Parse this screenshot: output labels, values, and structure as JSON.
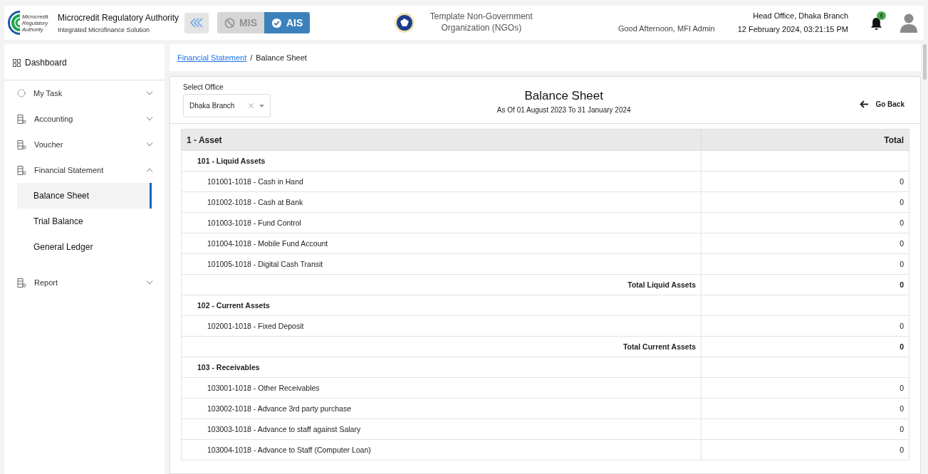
{
  "header": {
    "org_name": "Microcredit Regulatory Authority",
    "org_subtitle": "Integrated Microfinance Solution",
    "logo_text": "Microcredit Regulatory Authority",
    "modules": [
      {
        "label": "MIS",
        "selected": false
      },
      {
        "label": "AIS",
        "selected": true
      }
    ],
    "organization": "Template Non-Government Organization (NGOs)",
    "greeting": "Good Afternoon, MFI Admin",
    "office": "Head Office, Dhaka Branch",
    "datetime": "12 February 2024, 03:21:15 PM",
    "notification_count": "8"
  },
  "sidebar": {
    "dashboard": "Dashboard",
    "items": [
      {
        "label": "My Task",
        "kind": "task",
        "expanded": false
      },
      {
        "label": "Accounting",
        "kind": "doc",
        "expanded": false
      },
      {
        "label": "Voucher",
        "kind": "doc",
        "expanded": false
      },
      {
        "label": "Financial Statement",
        "kind": "doc",
        "expanded": true,
        "children": [
          {
            "label": "Balance Sheet",
            "selected": true
          },
          {
            "label": "Trial Balance",
            "selected": false
          },
          {
            "label": "General Ledger",
            "selected": false
          }
        ]
      },
      {
        "label": "Report",
        "kind": "doc",
        "expanded": false
      }
    ]
  },
  "breadcrumb": {
    "separator": "/",
    "items": [
      {
        "label": "Financial Statement",
        "link": true
      },
      {
        "label": "Balance Sheet",
        "link": false
      }
    ]
  },
  "report": {
    "office_label": "Select Office",
    "office_value": "Dhaka Branch",
    "title": "Balance Sheet",
    "period": "As Of 01 August 2023 To 31 January 2024",
    "back": "Go Back",
    "columns": [
      "1 - Asset",
      "Total"
    ],
    "rows": [
      {
        "kind": "group",
        "label": "101 - Liquid Assets"
      },
      {
        "kind": "account",
        "label": "101001-1018 - Cash in Hand",
        "value": "0"
      },
      {
        "kind": "account",
        "label": "101002-1018 - Cash at Bank",
        "value": "0"
      },
      {
        "kind": "account",
        "label": "101003-1018 - Fund Control",
        "value": "0"
      },
      {
        "kind": "account",
        "label": "101004-1018 - Mobile Fund Account",
        "value": "0"
      },
      {
        "kind": "account",
        "label": "101005-1018 - Digital Cash Transit",
        "value": "0"
      },
      {
        "kind": "total",
        "label": "Total Liquid Assets",
        "value": "0"
      },
      {
        "kind": "group",
        "label": "102 - Current Assets"
      },
      {
        "kind": "account",
        "label": "102001-1018 - Fixed Deposit",
        "value": "0"
      },
      {
        "kind": "total",
        "label": "Total Current Assets",
        "value": "0"
      },
      {
        "kind": "group",
        "label": "103 - Receivables"
      },
      {
        "kind": "account",
        "label": "103001-1018 - Other Receivables",
        "value": "0"
      },
      {
        "kind": "account",
        "label": "103002-1018 - Advance 3rd party purchase",
        "value": "0"
      },
      {
        "kind": "account",
        "label": "103003-1018 - Advance to staff against Salary",
        "value": "0"
      },
      {
        "kind": "account",
        "label": "103004-1018 - Advance to Staff (Computer Loan)",
        "value": "0"
      }
    ]
  }
}
